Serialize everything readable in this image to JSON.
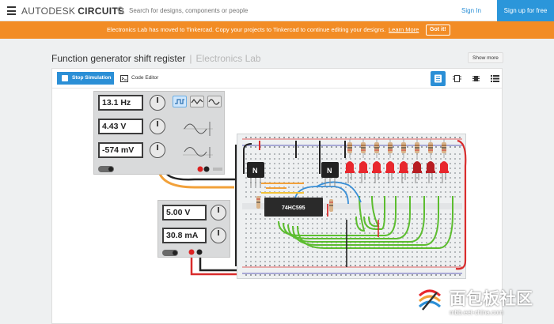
{
  "header": {
    "brand_prefix": "AUTODESK",
    "brand_name": "CIRCUITS",
    "search_placeholder": "Search for designs, components or people",
    "sign_in": "Sign In",
    "sign_up": "Sign up for free"
  },
  "banner": {
    "message": "Electronics Lab has moved to Tinkercad. Copy your projects to Tinkercad to continue editing your designs.",
    "learn_more": "Learn More",
    "got_it": "Got it!"
  },
  "project": {
    "title": "Function generator shift register",
    "separator": "|",
    "subtitle": "Electronics Lab",
    "show_more": "Show more"
  },
  "toolbar": {
    "stop_simulation": "Stop Simulation",
    "code_editor": "Code Editor"
  },
  "function_generator": {
    "frequency": "13.1 Hz",
    "amplitude": "4.43 V",
    "offset": "-574 mV"
  },
  "power_supply": {
    "voltage": "5.00 V",
    "current": "30.8 mA"
  },
  "breadboard": {
    "ic_label": "74HC595",
    "transistor_label": "N"
  },
  "watermark": {
    "text": "面包板社区",
    "url": "mbb.eet-china.com"
  },
  "colors": {
    "accent_blue": "#2b8fd6",
    "banner_orange": "#f28c25",
    "led_red": "#e8272d",
    "wire_green": "#5cbd2f",
    "wire_orange": "#f2a13a"
  }
}
